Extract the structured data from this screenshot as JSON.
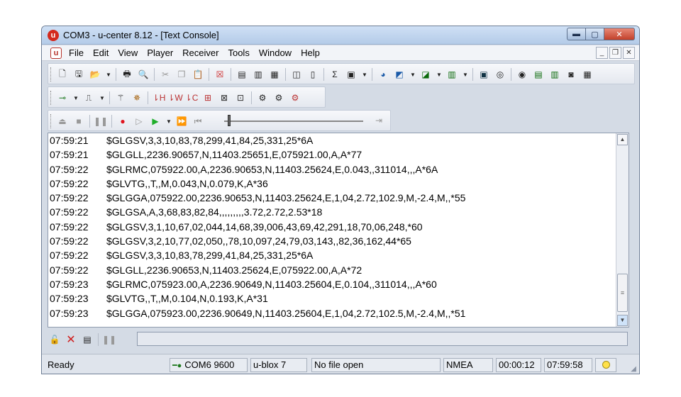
{
  "window": {
    "title": "COM3 - u-center 8.12 - [Text Console]",
    "buttons": {
      "minimize": "▬",
      "maximize": "▢",
      "close": "✕"
    }
  },
  "menu": {
    "items": [
      "File",
      "Edit",
      "View",
      "Player",
      "Receiver",
      "Tools",
      "Window",
      "Help"
    ],
    "mdi": {
      "minimize": "_",
      "restore": "❐",
      "close": "✕"
    }
  },
  "console": {
    "lines": [
      {
        "time": "07:59:21",
        "text": "$GLGSV,3,3,10,83,78,299,41,84,25,331,25*6A"
      },
      {
        "time": "07:59:21",
        "text": "$GLGLL,2236.90657,N,11403.25651,E,075921.00,A,A*77"
      },
      {
        "time": "07:59:22",
        "text": "$GLRMC,075922.00,A,2236.90653,N,11403.25624,E,0.043,,311014,,,A*6A"
      },
      {
        "time": "07:59:22",
        "text": "$GLVTG,,T,,M,0.043,N,0.079,K,A*36"
      },
      {
        "time": "07:59:22",
        "text": "$GLGGA,075922.00,2236.90653,N,11403.25624,E,1,04,2.72,102.9,M,-2.4,M,,*55"
      },
      {
        "time": "07:59:22",
        "text": "$GLGSA,A,3,68,83,82,84,,,,,,,,,3.72,2.72,2.53*18"
      },
      {
        "time": "07:59:22",
        "text": "$GLGSV,3,1,10,67,02,044,14,68,39,006,43,69,42,291,18,70,06,248,*60"
      },
      {
        "time": "07:59:22",
        "text": "$GLGSV,3,2,10,77,02,050,,78,10,097,24,79,03,143,,82,36,162,44*65"
      },
      {
        "time": "07:59:22",
        "text": "$GLGSV,3,3,10,83,78,299,41,84,25,331,25*6A"
      },
      {
        "time": "07:59:22",
        "text": "$GLGLL,2236.90653,N,11403.25624,E,075922.00,A,A*72"
      },
      {
        "time": "07:59:23",
        "text": "$GLRMC,075923.00,A,2236.90649,N,11403.25604,E,0.104,,311014,,,A*60"
      },
      {
        "time": "07:59:23",
        "text": "$GLVTG,,T,,M,0.104,N,0.193,K,A*31"
      },
      {
        "time": "07:59:23",
        "text": "$GLGGA,075923.00,2236.90649,N,11403.25604,E,1,04,2.72,102.5,M,-2.4,M,,*51"
      }
    ]
  },
  "command": {
    "value": ""
  },
  "status": {
    "ready": "Ready",
    "port": "COM6 9600",
    "receiver": "u-blox 7",
    "file": "No file open",
    "protocol": "NMEA",
    "elapsed": "00:00:12",
    "clock": "07:59:58"
  },
  "colors": {
    "led": "#ffe14a",
    "record": "#e0141e",
    "play": "#1fae2a",
    "close_button": "#c2402a"
  }
}
